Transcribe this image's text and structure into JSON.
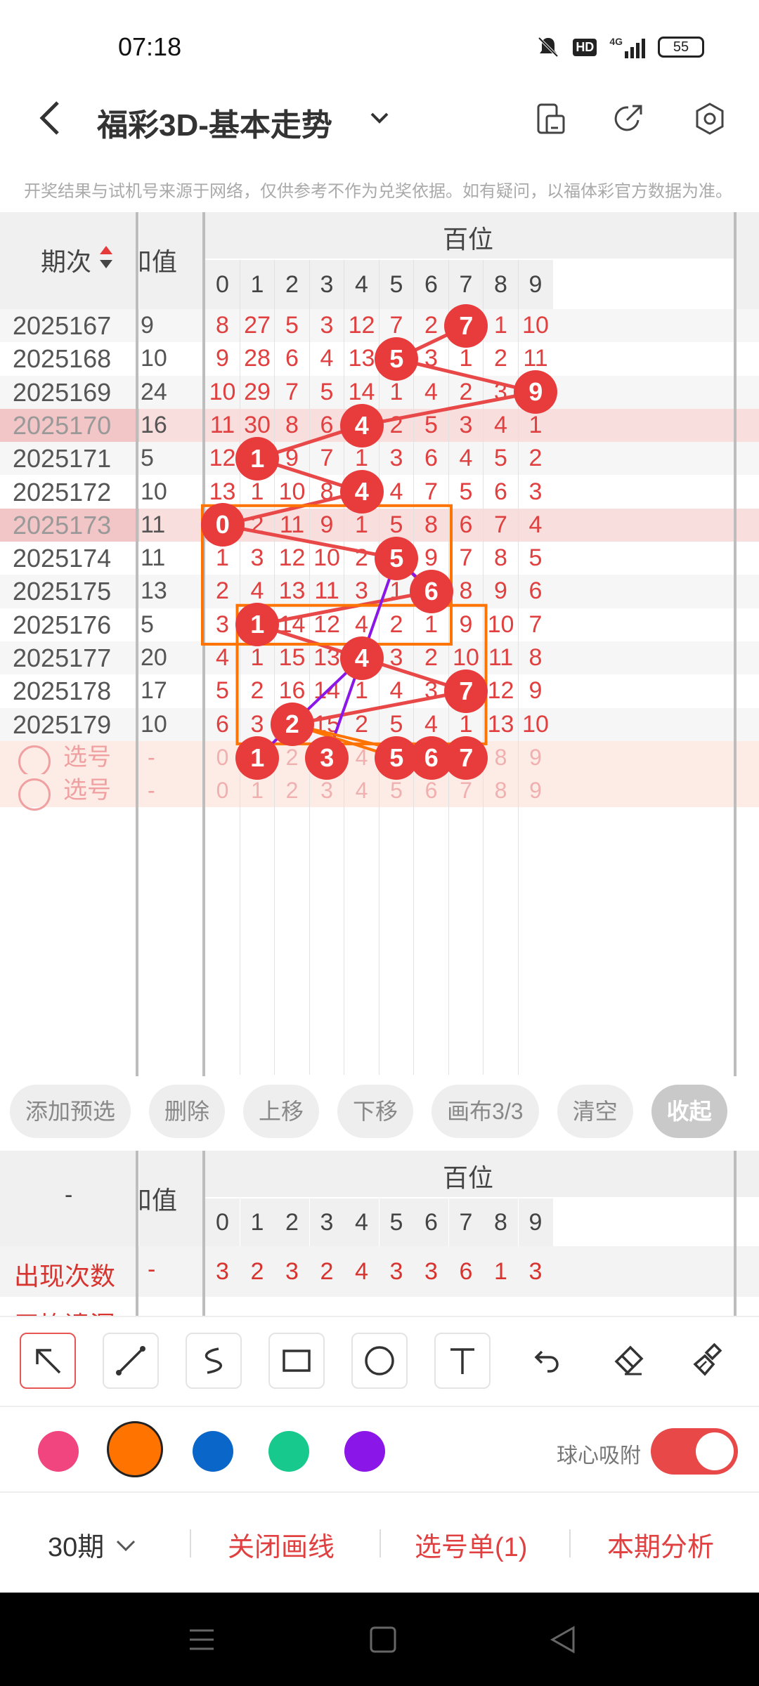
{
  "status_bar": {
    "time": "07:18",
    "network": "4G",
    "battery": "55"
  },
  "header": {
    "back_icon": "chevron-left-icon",
    "title": "福彩3D-基本走势",
    "dropdown_icon": "chevron-down-icon",
    "icons": [
      "phone-layout-icon",
      "share-icon",
      "settings-icon"
    ]
  },
  "notice": "开奖结果与试机号来源于网络，仅供参考不作为兑奖依据。如有疑问，以福体彩官方数据为准。",
  "table": {
    "col_period": "期次",
    "col_value": "和值",
    "group_label": "百位",
    "digits": [
      "0",
      "1",
      "2",
      "3",
      "4",
      "5",
      "6",
      "7",
      "8",
      "9"
    ],
    "rows": [
      {
        "period": "2025167",
        "value": "9",
        "cells": [
          "8",
          "27",
          "5",
          "3",
          "12",
          "7",
          "2",
          "7",
          "1",
          "10"
        ],
        "hit": 7
      },
      {
        "period": "2025168",
        "value": "10",
        "cells": [
          "9",
          "28",
          "6",
          "4",
          "13",
          "5",
          "3",
          "1",
          "2",
          "11"
        ],
        "hit": 5
      },
      {
        "period": "2025169",
        "value": "24",
        "cells": [
          "10",
          "29",
          "7",
          "5",
          "14",
          "1",
          "4",
          "2",
          "3",
          "9"
        ],
        "hit": 9
      },
      {
        "period": "2025170",
        "value": "16",
        "cells": [
          "11",
          "30",
          "8",
          "6",
          "4",
          "2",
          "5",
          "3",
          "4",
          "1"
        ],
        "hit": 4
      },
      {
        "period": "2025171",
        "value": "5",
        "cells": [
          "12",
          "1",
          "9",
          "7",
          "1",
          "3",
          "6",
          "4",
          "5",
          "2"
        ],
        "hit": 1
      },
      {
        "period": "2025172",
        "value": "10",
        "cells": [
          "13",
          "1",
          "10",
          "8",
          "4",
          "4",
          "7",
          "5",
          "6",
          "3"
        ],
        "hit": 4
      },
      {
        "period": "2025173",
        "value": "11",
        "cells": [
          "0",
          "2",
          "11",
          "9",
          "1",
          "5",
          "8",
          "6",
          "7",
          "4"
        ],
        "hit": 0
      },
      {
        "period": "2025174",
        "value": "11",
        "cells": [
          "1",
          "3",
          "12",
          "10",
          "2",
          "5",
          "9",
          "7",
          "8",
          "5"
        ],
        "hit": 5
      },
      {
        "period": "2025175",
        "value": "13",
        "cells": [
          "2",
          "4",
          "13",
          "11",
          "3",
          "1",
          "6",
          "8",
          "9",
          "6"
        ],
        "hit": 6
      },
      {
        "period": "2025176",
        "value": "5",
        "cells": [
          "3",
          "1",
          "14",
          "12",
          "4",
          "2",
          "1",
          "9",
          "10",
          "7"
        ],
        "hit": 1
      },
      {
        "period": "2025177",
        "value": "20",
        "cells": [
          "4",
          "1",
          "15",
          "13",
          "4",
          "3",
          "2",
          "10",
          "11",
          "8"
        ],
        "hit": 4
      },
      {
        "period": "2025178",
        "value": "17",
        "cells": [
          "5",
          "2",
          "16",
          "14",
          "1",
          "4",
          "3",
          "7",
          "12",
          "9"
        ],
        "hit": 7
      },
      {
        "period": "2025179",
        "value": "10",
        "cells": [
          "6",
          "3",
          "2",
          "15",
          "2",
          "5",
          "4",
          "1",
          "13",
          "10"
        ],
        "hit": 2
      }
    ],
    "pick_rows": [
      {
        "label": "选号",
        "value": "-",
        "cells": [
          "0",
          "1",
          "2",
          "3",
          "4",
          "5",
          "6",
          "7",
          "8",
          "9"
        ],
        "selected": [
          1,
          3,
          5,
          6,
          7
        ]
      },
      {
        "label": "选号",
        "value": "-",
        "cells": [
          "0",
          "1",
          "2",
          "3",
          "4",
          "5",
          "6",
          "7",
          "8",
          "9"
        ],
        "selected": []
      }
    ]
  },
  "toolbar": [
    "添加预选",
    "删除",
    "上移",
    "下移",
    "画布3/3",
    "清空",
    "收起"
  ],
  "stats": {
    "col_label": "-",
    "col_value": "和值",
    "group_label": "百位",
    "digits": [
      "0",
      "1",
      "2",
      "3",
      "4",
      "5",
      "6",
      "7",
      "8",
      "9"
    ],
    "row1_label": "出现次数",
    "row1_value": "-",
    "row1_cells": [
      "3",
      "2",
      "3",
      "2",
      "4",
      "3",
      "3",
      "6",
      "1",
      "3"
    ],
    "row2_label": "平均遗漏"
  },
  "draw_tools": [
    "pointer-arrow-icon",
    "line-icon",
    "curve-icon",
    "rectangle-icon",
    "circle-icon",
    "text-icon",
    "undo-icon",
    "eraser-icon",
    "clear-brush-icon"
  ],
  "colors": [
    "#f0457f",
    "#ff7300",
    "#0a66c8",
    "#17c98c",
    "#8a16e8"
  ],
  "snap_label": "球心吸附",
  "snap_on": true,
  "bottom_bar": {
    "periods": "30期",
    "close_lines": "关闭画线",
    "pick_list": "选号单(1)",
    "analysis": "本期分析"
  }
}
